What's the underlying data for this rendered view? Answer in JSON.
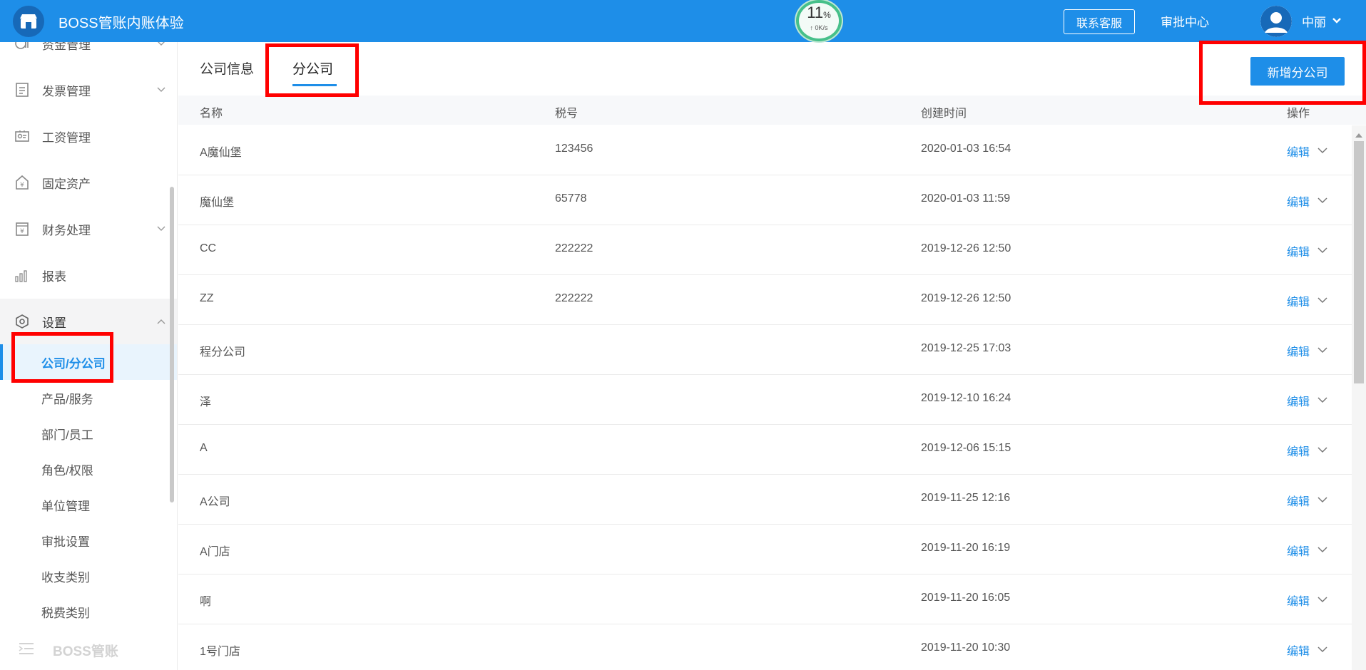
{
  "header": {
    "app_title": "BOSS管账内账体验",
    "net_monitor": {
      "percent": "11",
      "percent_unit": "%",
      "speed": "↑ 0K/s"
    },
    "service_button": "联系客服",
    "approval_center": "审批中心",
    "user_name": "中丽",
    "colors": {
      "bar": "#1e8ee8"
    }
  },
  "sidebar": {
    "items": [
      {
        "label": "资金管理",
        "icon": "money-icon"
      },
      {
        "label": "发票管理",
        "icon": "invoice-icon"
      },
      {
        "label": "工资管理",
        "icon": "salary-icon"
      },
      {
        "label": "固定资产",
        "icon": "asset-icon"
      },
      {
        "label": "财务处理",
        "icon": "finance-icon"
      },
      {
        "label": "报表",
        "icon": "chart-icon"
      },
      {
        "label": "设置",
        "icon": "settings-icon"
      }
    ],
    "subitems": [
      {
        "label": "公司/分公司",
        "active": true
      },
      {
        "label": "产品/服务"
      },
      {
        "label": "部门/员工"
      },
      {
        "label": "角色/权限"
      },
      {
        "label": "单位管理"
      },
      {
        "label": "审批设置"
      },
      {
        "label": "收支类别"
      },
      {
        "label": "税费类别"
      }
    ],
    "footer_label": "BOSS管账"
  },
  "main": {
    "tabs": [
      {
        "label": "公司信息"
      },
      {
        "label": "分公司",
        "active": true
      }
    ],
    "add_button": "新增分公司",
    "table": {
      "columns": [
        "名称",
        "税号",
        "创建时间",
        "操作"
      ],
      "edit_label": "编辑",
      "rows": [
        {
          "name": "A魔仙堡",
          "tax": "123456",
          "time": "2020-01-03 16:54"
        },
        {
          "name": "魔仙堡",
          "tax": "65778",
          "time": "2020-01-03 11:59"
        },
        {
          "name": "CC",
          "tax": "222222",
          "time": "2019-12-26 12:50"
        },
        {
          "name": "ZZ",
          "tax": "222222",
          "time": "2019-12-26 12:50"
        },
        {
          "name": "程分公司",
          "tax": "",
          "time": "2019-12-25 17:03"
        },
        {
          "name": "泽",
          "tax": "",
          "time": "2019-12-10 16:24"
        },
        {
          "name": "A",
          "tax": "",
          "time": "2019-12-06 15:15"
        },
        {
          "name": "A公司",
          "tax": "",
          "time": "2019-11-25 12:16"
        },
        {
          "name": "A门店",
          "tax": "",
          "time": "2019-11-20 16:19"
        },
        {
          "name": "啊",
          "tax": "",
          "time": "2019-11-20 16:05"
        },
        {
          "name": "1号门店",
          "tax": "",
          "time": "2019-11-20 10:30"
        }
      ]
    }
  }
}
